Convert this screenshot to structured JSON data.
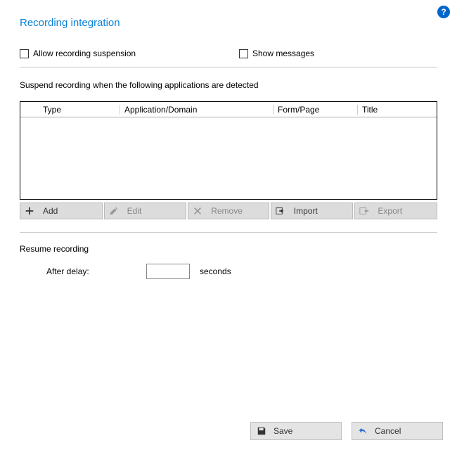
{
  "title": "Recording integration",
  "checkboxes": {
    "allow_suspension": "Allow recording suspension",
    "show_messages": "Show messages"
  },
  "suspend_label": "Suspend recording when the following applications are detected",
  "table": {
    "headers": [
      "Type",
      "Application/Domain",
      "Form/Page",
      "Title"
    ],
    "rows": []
  },
  "toolbar": {
    "add": "Add",
    "edit": "Edit",
    "remove": "Remove",
    "import": "Import",
    "export": "Export"
  },
  "resume": {
    "section": "Resume recording",
    "after_delay": "After delay:",
    "value": "",
    "unit": "seconds"
  },
  "footer": {
    "save": "Save",
    "cancel": "Cancel"
  },
  "help": "?"
}
